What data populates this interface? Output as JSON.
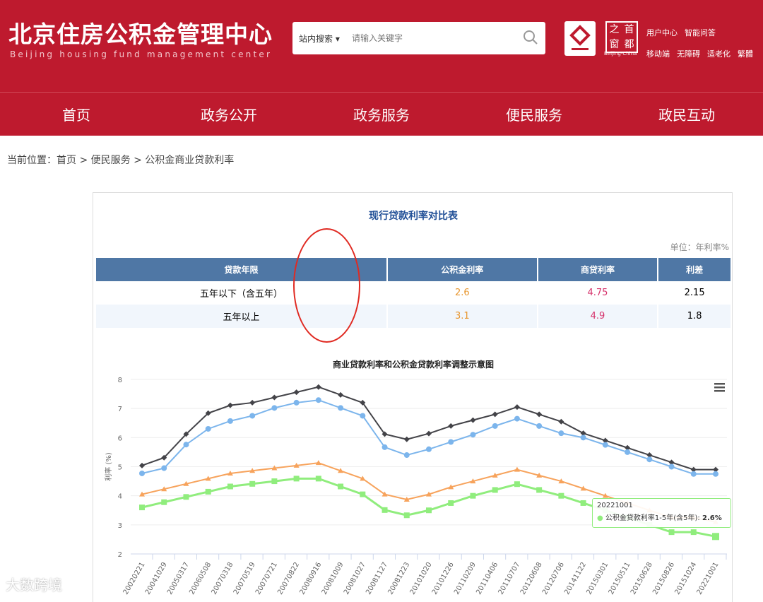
{
  "header": {
    "title_cn": "北京住房公积金管理中心",
    "title_en": "Beijing housing fund management center",
    "search_scope": "站内搜索",
    "search_placeholder": "请输入关键字",
    "badge_text": [
      "之",
      "首",
      "窗",
      "都"
    ],
    "badge_en": "Beijing-China",
    "links_top": [
      "用户中心",
      "智能问答"
    ],
    "links_bottom": [
      "移动端",
      "无障碍",
      "适老化",
      "繁體"
    ]
  },
  "nav": [
    "首页",
    "政务公开",
    "政务服务",
    "便民服务",
    "政民互动"
  ],
  "breadcrumb": "当前位置：首页 > 便民服务 > 公积金商业贷款利率",
  "table": {
    "title": "现行贷款利率对比表",
    "unit": "单位：年利率%",
    "headers": [
      "贷款年限",
      "公积金利率",
      "商贷利率",
      "利差"
    ],
    "rows": [
      [
        "五年以下（含五年）",
        "2.6",
        "4.75",
        "2.15"
      ],
      [
        "五年以上",
        "3.1",
        "4.9",
        "1.8"
      ]
    ]
  },
  "colors": {
    "brand": "#be1a2e",
    "gjj": "#e8962e",
    "commercial": "#d6336c",
    "black": "#434348",
    "blue": "#7cb5ec",
    "orange": "#f7a35c",
    "green": "#90ed7d"
  },
  "watermark": "大数跨境",
  "chart_data": {
    "type": "line",
    "title": "商业贷款利率和公积金贷款利率调整示意图",
    "ylabel": "利率 (%)",
    "ylim": [
      2,
      8
    ],
    "yticks": [
      2,
      3,
      4,
      5,
      6,
      7,
      8
    ],
    "categories": [
      "20020221",
      "20041029",
      "20050317",
      "20060508",
      "20070318",
      "20070519",
      "20070721",
      "20070822",
      "20080916",
      "20081009",
      "20081027",
      "20081127",
      "20081223",
      "20101020",
      "20101226",
      "20110209",
      "20110406",
      "20110707",
      "20120608",
      "20120706",
      "20141122",
      "20150301",
      "20150511",
      "20150628",
      "20150826",
      "20151024",
      "20221001"
    ],
    "series": [
      {
        "color": "#434348",
        "marker": "diamond",
        "values": [
          5.04,
          5.31,
          6.12,
          6.84,
          7.11,
          7.2,
          7.38,
          7.56,
          7.74,
          7.47,
          7.2,
          6.12,
          5.94,
          6.14,
          6.4,
          6.6,
          6.8,
          7.05,
          6.8,
          6.55,
          6.15,
          5.9,
          5.65,
          5.4,
          5.15,
          4.9,
          4.9
        ]
      },
      {
        "color": "#7cb5ec",
        "marker": "circle",
        "values": [
          4.77,
          4.95,
          5.76,
          6.3,
          6.57,
          6.75,
          7.02,
          7.2,
          7.29,
          7.02,
          6.75,
          5.67,
          5.4,
          5.6,
          5.85,
          6.1,
          6.4,
          6.65,
          6.4,
          6.15,
          6.0,
          5.75,
          5.5,
          5.25,
          5.0,
          4.75,
          4.75
        ]
      },
      {
        "color": "#f7a35c",
        "marker": "triangle",
        "values": [
          4.05,
          4.23,
          4.41,
          4.59,
          4.77,
          4.86,
          4.95,
          5.04,
          5.13,
          4.86,
          4.59,
          4.05,
          3.87,
          4.05,
          4.3,
          4.5,
          4.7,
          4.9,
          4.7,
          4.5,
          4.25,
          4.0,
          3.75,
          3.5,
          3.25,
          3.25,
          3.1
        ]
      },
      {
        "name": "公积金贷款利率1-5年(含5年)",
        "color": "#90ed7d",
        "marker": "square",
        "values": [
          3.6,
          3.78,
          3.96,
          4.14,
          4.32,
          4.41,
          4.5,
          4.59,
          4.59,
          4.32,
          4.05,
          3.51,
          3.33,
          3.5,
          3.75,
          4.0,
          4.2,
          4.4,
          4.2,
          4.0,
          3.75,
          3.5,
          3.25,
          3.0,
          2.75,
          2.75,
          2.6
        ]
      }
    ],
    "tooltip": {
      "date": "20221001",
      "label": "公积金贷款利率1-5年(含5年):",
      "value": "2.6%"
    }
  }
}
